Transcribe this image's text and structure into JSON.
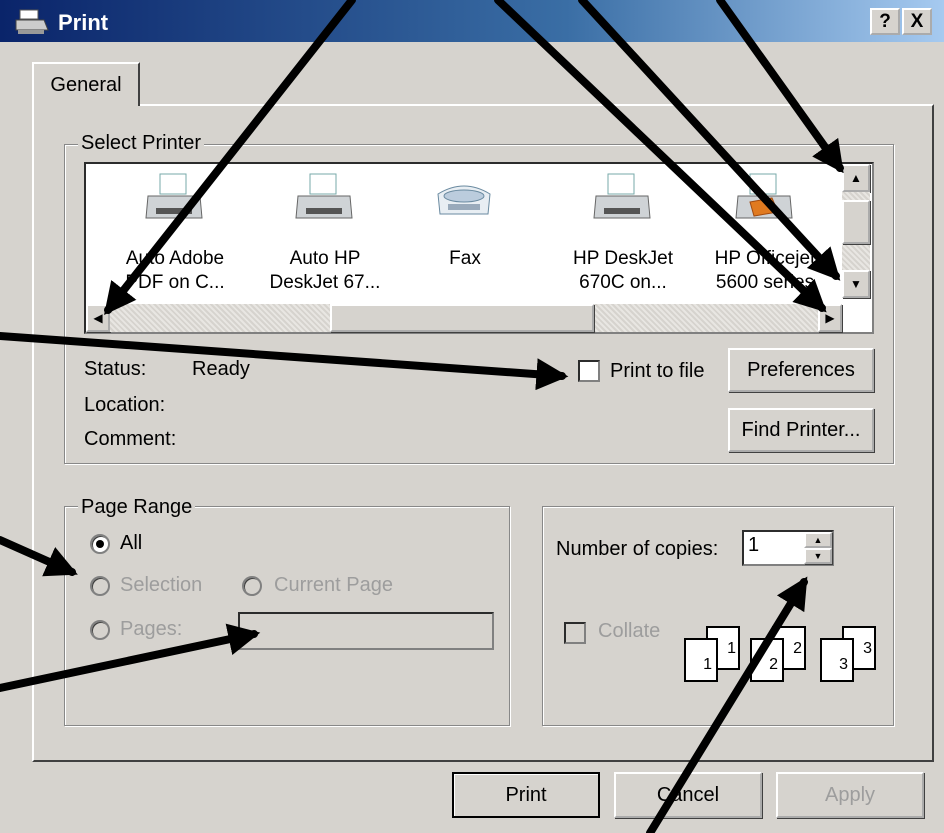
{
  "window": {
    "title": "Print",
    "help_btn": "?",
    "close_btn": "X"
  },
  "tabs": [
    {
      "label": "General"
    }
  ],
  "select_printer": {
    "legend": "Select Printer",
    "printers": [
      {
        "line1": "Auto Adobe",
        "line2": "PDF on C...",
        "icon": "printer-icon"
      },
      {
        "line1": "Auto HP",
        "line2": "DeskJet 67...",
        "icon": "printer-icon"
      },
      {
        "line1": "Fax",
        "line2": "",
        "icon": "fax-icon"
      },
      {
        "line1": "HP DeskJet",
        "line2": "670C on...",
        "icon": "printer-icon"
      },
      {
        "line1": "HP Officejet",
        "line2": "5600 series",
        "icon": "printer-icon"
      }
    ],
    "status_label": "Status:",
    "status_value": "Ready",
    "location_label": "Location:",
    "comment_label": "Comment:",
    "print_to_file": "Print to file",
    "preferences": "Preferences",
    "find_printer": "Find Printer..."
  },
  "page_range": {
    "legend": "Page Range",
    "all": "All",
    "selection": "Selection",
    "current_page": "Current Page",
    "pages": "Pages:"
  },
  "copies": {
    "label": "Number of copies:",
    "value": "1",
    "collate": "Collate",
    "collate_digits": [
      "1",
      "1",
      "2",
      "2",
      "3",
      "3"
    ]
  },
  "buttons": {
    "print": "Print",
    "cancel": "Cancel",
    "apply": "Apply"
  }
}
